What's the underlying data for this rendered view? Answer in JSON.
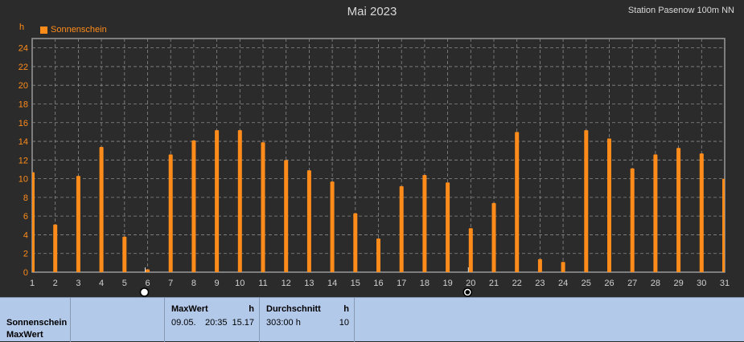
{
  "header": {
    "title": "Mai 2023",
    "station": "Station Pasenow 100m NN",
    "unit_label": "h"
  },
  "legend": {
    "label": "Sonnenschein",
    "color": "#ff8c1a"
  },
  "colors": {
    "bar": "#ff8c1a",
    "text": "#ff8c1a",
    "grid": "#8a8a8a",
    "background": "#2b2b2b"
  },
  "markers": [
    {
      "name": "full-moon-icon",
      "day": 6
    },
    {
      "name": "new-moon-icon",
      "day": 20
    }
  ],
  "chart_data": {
    "type": "bar",
    "title": "Mai 2023",
    "ylabel": "h",
    "ylim": [
      0,
      25
    ],
    "yticks": [
      0,
      2,
      4,
      6,
      8,
      10,
      12,
      14,
      16,
      18,
      20,
      22,
      24
    ],
    "grid": true,
    "legend_position": "top-left",
    "categories": [
      "1",
      "2",
      "3",
      "4",
      "5",
      "6",
      "7",
      "8",
      "9",
      "10",
      "11",
      "12",
      "13",
      "14",
      "15",
      "16",
      "17",
      "18",
      "19",
      "20",
      "21",
      "22",
      "23",
      "24",
      "25",
      "26",
      "27",
      "28",
      "29",
      "30",
      "31"
    ],
    "series": [
      {
        "name": "Sonnenschein",
        "values": [
          10.7,
          5.1,
          10.3,
          13.4,
          3.8,
          0.3,
          12.6,
          14.1,
          15.2,
          15.2,
          13.9,
          12.0,
          10.9,
          9.7,
          6.3,
          3.6,
          9.2,
          10.4,
          9.6,
          4.7,
          7.4,
          15.0,
          1.4,
          1.1,
          15.2,
          14.3,
          11.1,
          12.6,
          13.3,
          12.7,
          10.0
        ]
      }
    ]
  },
  "summary_table": {
    "row_label_1": "Sonnenschein",
    "row_label_2": "MaxWert",
    "max": {
      "header": "MaxWert",
      "unit": "h",
      "date": "09.05.",
      "time": "20:35",
      "value": "15.17"
    },
    "avg": {
      "header": "Durchschnitt",
      "unit": "h",
      "total": "303:00 h",
      "value": "10"
    }
  }
}
